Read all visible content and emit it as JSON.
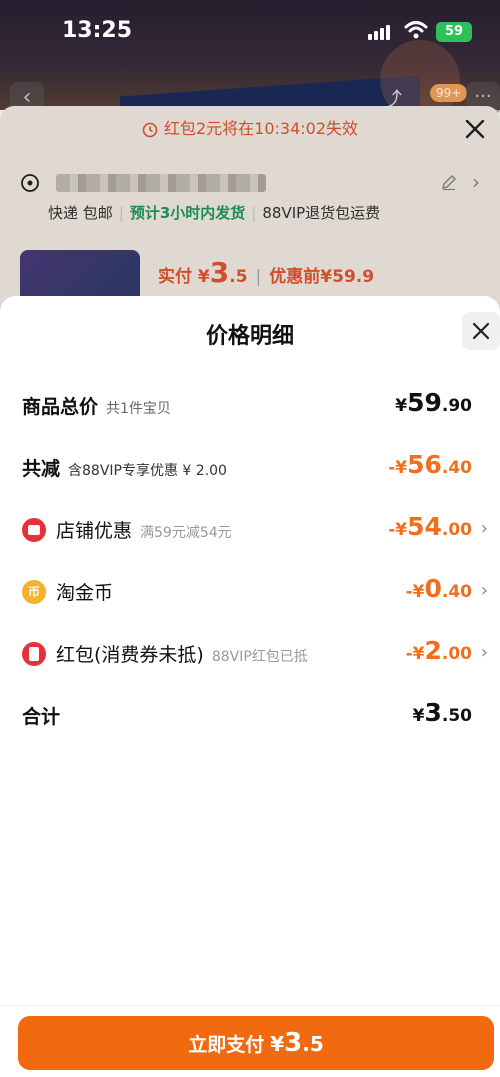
{
  "status_bar": {
    "time": "13:25",
    "battery": "59"
  },
  "background": {
    "badge": "99+",
    "timer_text": "红包2元将在10:34:02失效",
    "shipping": {
      "method": "快递 包邮",
      "eta": "预计3小时内发货",
      "vip": "88VIP退货包运费"
    },
    "price": {
      "label": "实付",
      "yen": "¥",
      "int": "3",
      "dec": ".5",
      "before_label": "优惠前",
      "before": "¥59.9"
    }
  },
  "sheet": {
    "title": "价格明细",
    "rows": [
      {
        "label": "商品总价",
        "sub": "共1件宝贝",
        "yen": "¥",
        "int": "59",
        "dec": ".90"
      },
      {
        "label": "共减",
        "sub": "含88VIP专享优惠 ¥ 2.00",
        "yen": "-¥",
        "int": "56",
        "dec": ".40"
      },
      {
        "label": "店铺优惠",
        "sub": "满59元减54元",
        "yen": "-¥",
        "int": "54",
        "dec": ".00",
        "icon": "store-icon"
      },
      {
        "label": "淘金币",
        "sub": "",
        "yen": "-¥",
        "int": "0",
        "dec": ".40",
        "icon": "coin-icon",
        "coin_glyph": "币"
      },
      {
        "label": "红包(消费券未抵)",
        "sub": "88VIP红包已抵",
        "yen": "-¥",
        "int": "2",
        "dec": ".00",
        "icon": "red-packet-icon"
      },
      {
        "label": "合计",
        "sub": "",
        "yen": "¥",
        "int": "3",
        "dec": ".50"
      }
    ],
    "pay_button": {
      "label": "立即支付",
      "yen": "¥",
      "int": "3",
      "dec": ".5"
    }
  },
  "colors": {
    "accent": "#f26a10",
    "discount": "#f06e1e",
    "timer": "#e2552e",
    "eta": "#1f9a5a"
  }
}
